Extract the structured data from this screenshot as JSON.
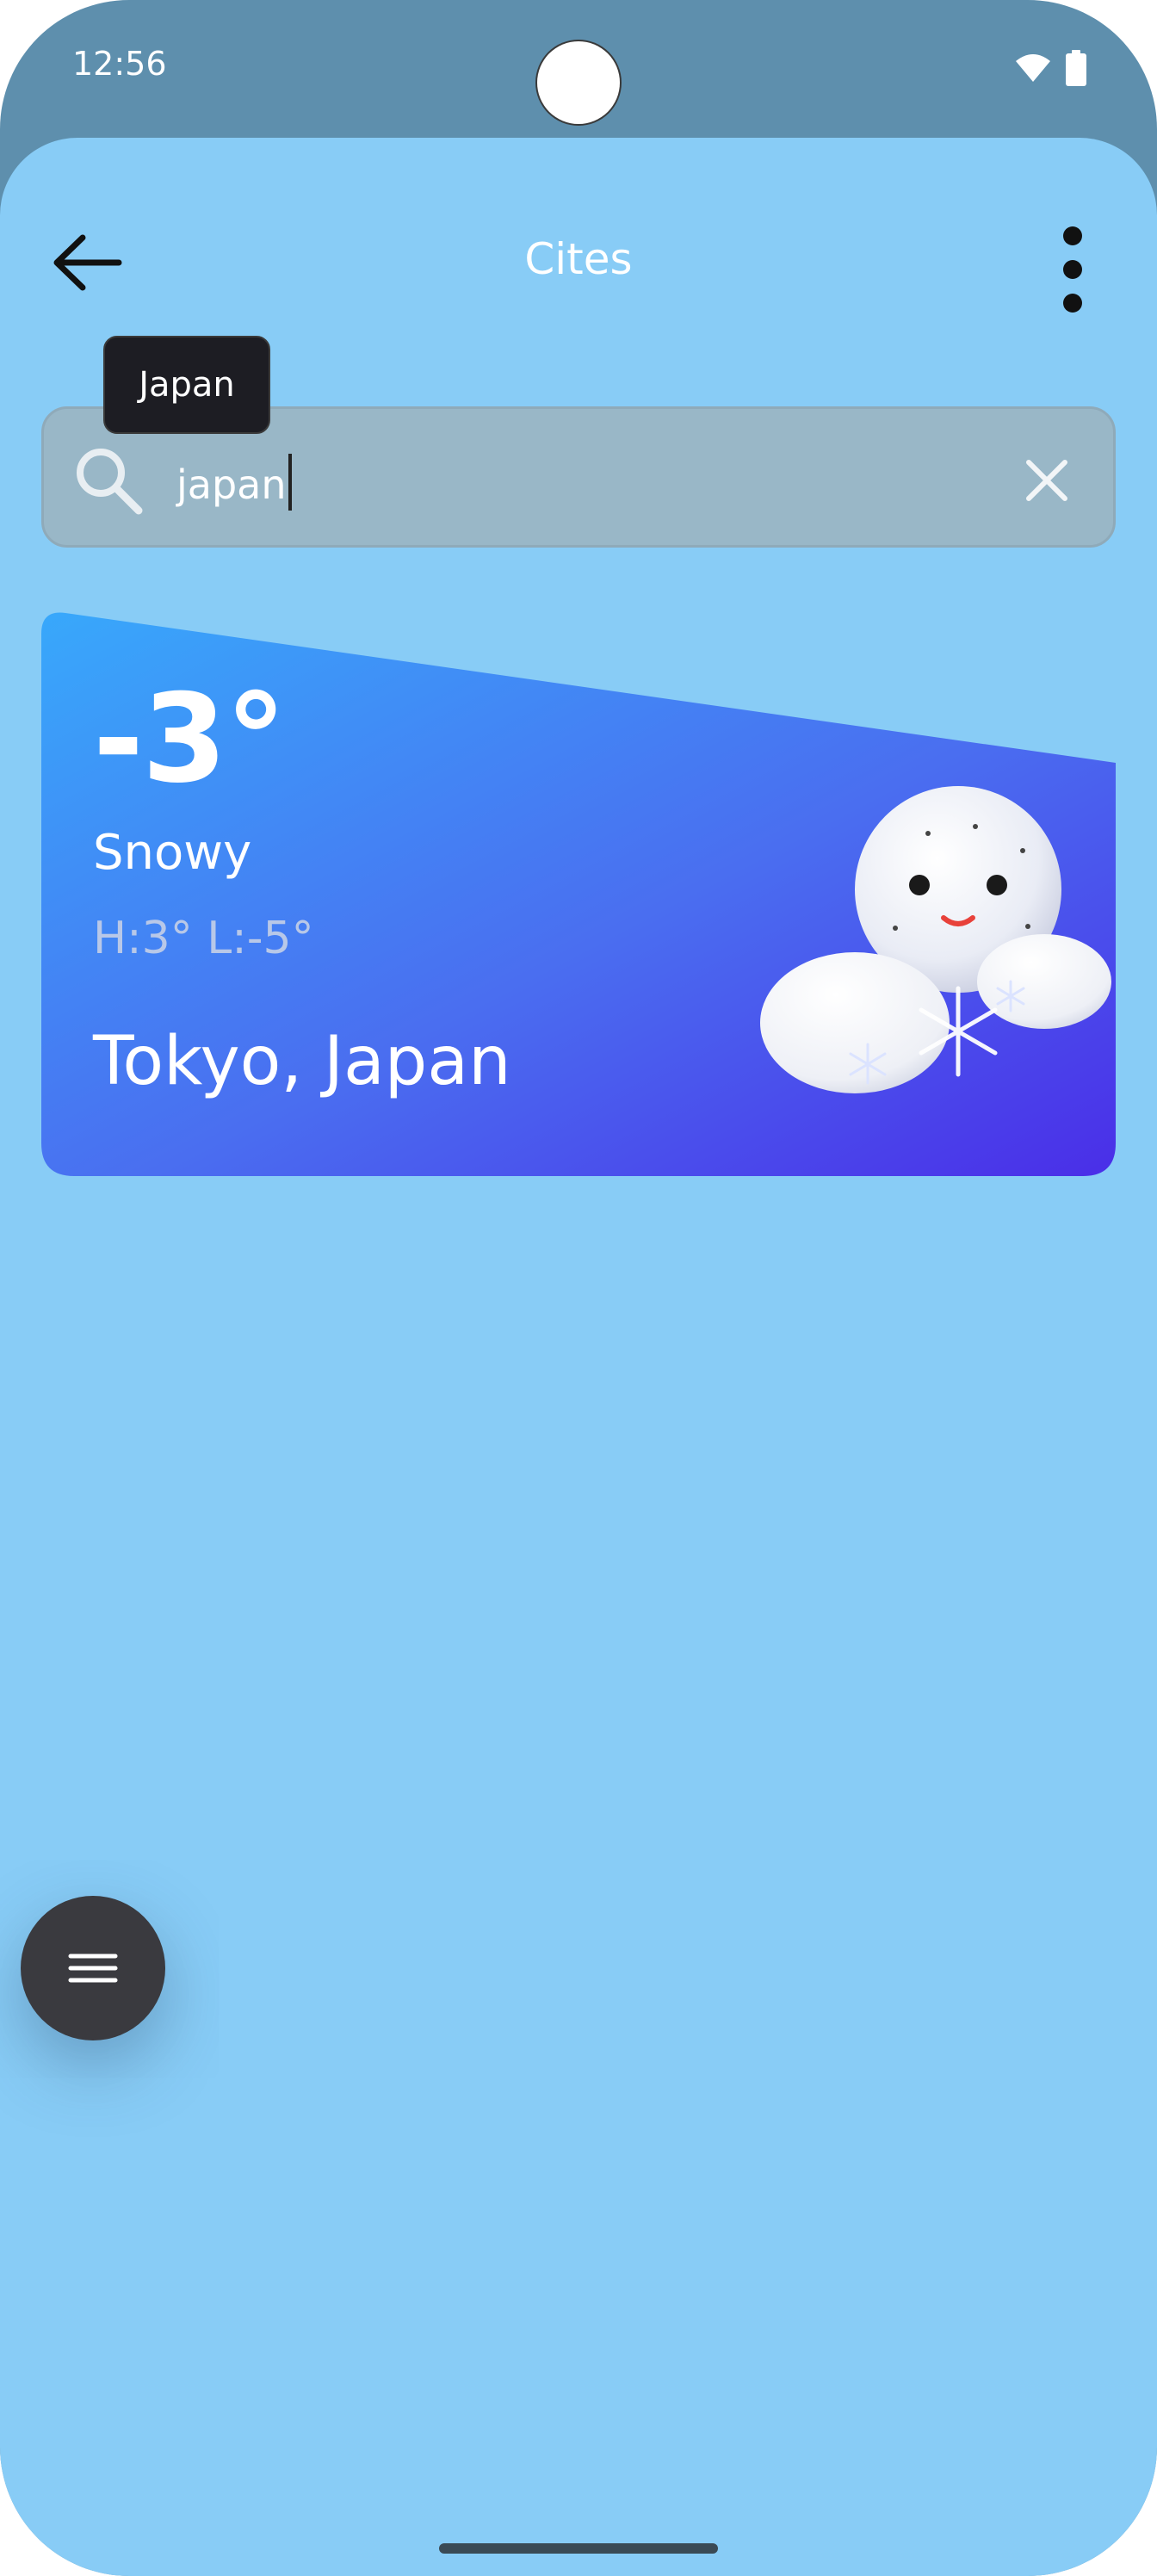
{
  "status_bar": {
    "time": "12:56",
    "wifi_icon": "wifi-icon",
    "battery_icon": "battery-icon"
  },
  "app_bar": {
    "title": "Cites",
    "back_icon": "arrow-left-icon",
    "menu_icon": "more-vert-icon"
  },
  "search": {
    "value": "japan",
    "suggestion_tooltip": "Japan",
    "search_icon": "search-icon",
    "clear_icon": "close-icon"
  },
  "weather_card": {
    "temperature": "-3°",
    "condition": "Snowy",
    "high_low": "H:3° L:-5°",
    "location": "Tokyo, Japan",
    "illustration": "snowy-cloud-icon",
    "gradient_start": "#3aa3f7",
    "gradient_end": "#4a2ee6"
  },
  "fab": {
    "icon": "menu-icon",
    "color": "#3a3a3f"
  },
  "colors": {
    "background": "#88ccf6",
    "status_bar": "#5e8fad",
    "search_bar": "#99b7c7"
  }
}
